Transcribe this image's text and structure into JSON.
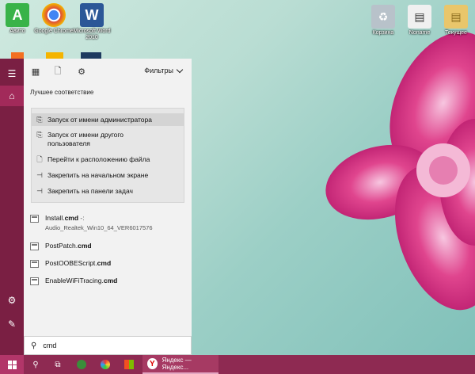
{
  "desktop_icons": [
    {
      "label": "Авито",
      "icon": "avito-icon",
      "color": "#38b349",
      "glyph": "A"
    },
    {
      "label": "Google Chrome",
      "icon": "chrome-icon",
      "color": "#dd4b39",
      "glyph": "●"
    },
    {
      "label": "Microsoft Word 2010",
      "icon": "word-icon",
      "color": "#2b5797",
      "glyph": "W"
    },
    {
      "label": "Корзина",
      "icon": "recycle-bin-icon",
      "color": "#9aa5ae",
      "glyph": "🗑"
    },
    {
      "label": "Noname",
      "icon": "file-icon",
      "color": "#e8e8e8",
      "glyph": "▤"
    },
    {
      "label": "Текущее",
      "icon": "folder-icon",
      "color": "#e9c66b",
      "glyph": "▤"
    }
  ],
  "search": {
    "filters_label": "Фильтры",
    "best_match_title": "Лучшее соответствие",
    "query": "cmd"
  },
  "context_menu": [
    {
      "label": "Запуск от имени администратора",
      "icon": "admin-run-icon",
      "hover": true
    },
    {
      "label": "Запуск от имени другого пользователя",
      "icon": "other-user-run-icon"
    },
    {
      "label": "Перейти к расположению файла",
      "icon": "open-location-icon"
    },
    {
      "label": "Закрепить на начальном экране",
      "icon": "pin-start-icon"
    },
    {
      "label": "Закрепить на панели задач",
      "icon": "pin-taskbar-icon"
    }
  ],
  "results": [
    {
      "name_plain": "Install.",
      "name_bold": "cmd",
      "suffix": " -:",
      "subtitle": "Audio_Realtek_Win10_64_VER6017576"
    },
    {
      "name_plain": "PostPatch.",
      "name_bold": "cmd",
      "suffix": "",
      "subtitle": ""
    },
    {
      "name_plain": "PostOOBEScript.",
      "name_bold": "cmd",
      "suffix": "",
      "subtitle": ""
    },
    {
      "name_plain": "EnableWiFiTracing.",
      "name_bold": "cmd",
      "suffix": "",
      "subtitle": ""
    }
  ],
  "taskbar": {
    "yandex_label": "Яндекс — Яндекс..."
  },
  "colors": {
    "accent": "#7a1f43",
    "taskbar": "#8e2a52"
  }
}
